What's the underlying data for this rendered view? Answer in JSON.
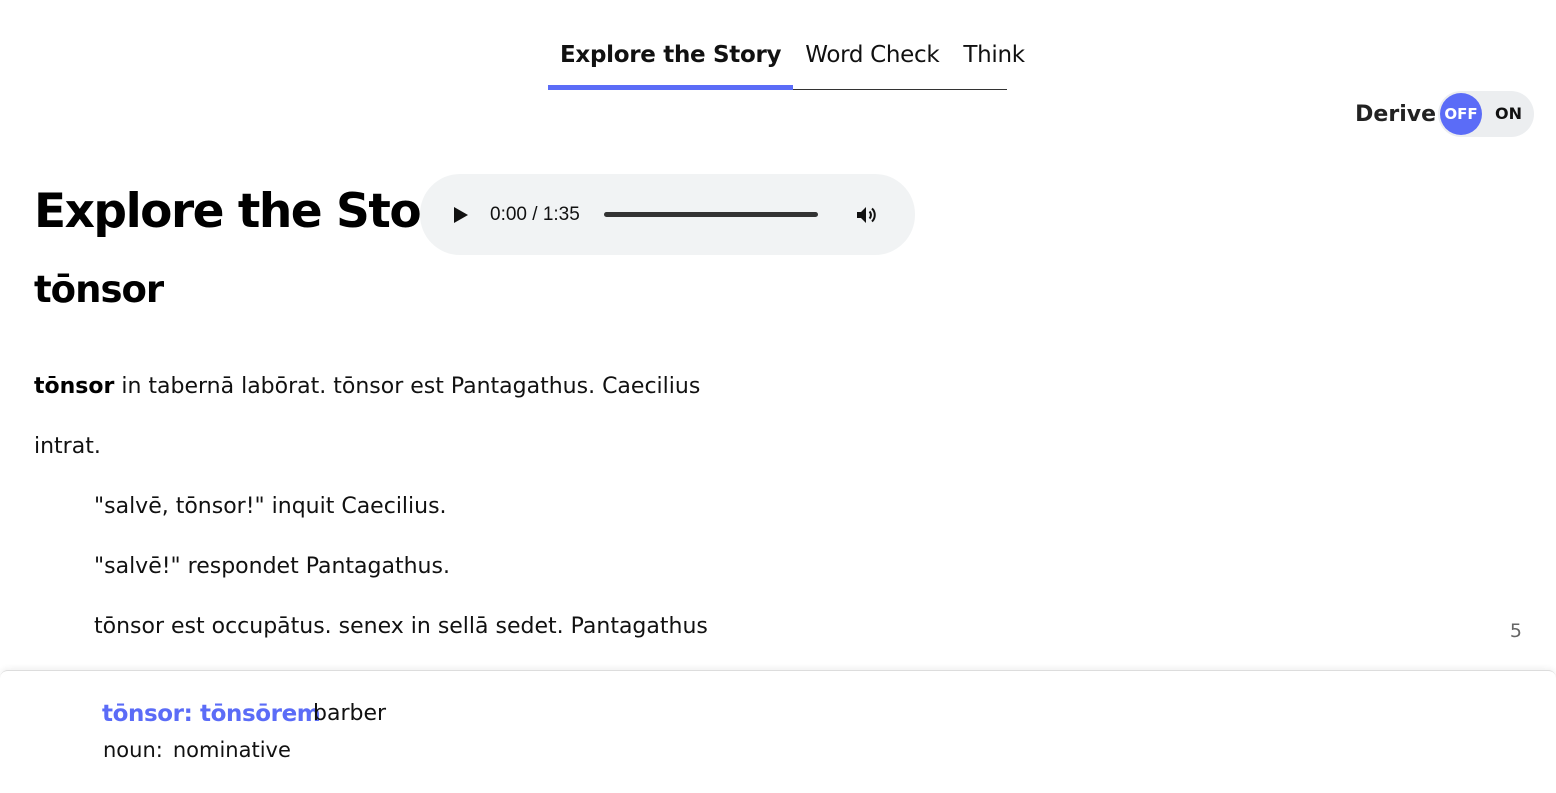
{
  "tabs": [
    {
      "label": "Explore the Story",
      "active": true
    },
    {
      "label": "Word Check",
      "active": false
    },
    {
      "label": "Think",
      "active": false
    }
  ],
  "derive": {
    "label": "Derive",
    "off_label": "OFF",
    "on_label": "ON",
    "state": "OFF"
  },
  "header": {
    "title": "Explore the Story",
    "subtitle": "tōnsor"
  },
  "audio": {
    "time": "0:00 / 1:35",
    "progress": 0
  },
  "story": {
    "line1": {
      "highlight": "tōnsor",
      "rest": " in tabernā labōrat. tōnsor est Pantagathus. Caecilius"
    },
    "line2": "intrat.",
    "line3": "\"salvē, tōnsor!\" inquit Caecilius.",
    "line4": "\"salvē!\" respondet Pantagathus.",
    "line5": "tōnsor est occupātus. senex in sellā sedet. Pantagathus",
    "line_number": "5"
  },
  "definition": {
    "headword": "tōnsor: tōnsōrem",
    "gloss": "barber",
    "pos": "noun:",
    "case": "nominative"
  },
  "colors": {
    "accent": "#5b6cf7",
    "audio_bg": "#f1f3f4",
    "toggle_bg": "#eceef0"
  }
}
